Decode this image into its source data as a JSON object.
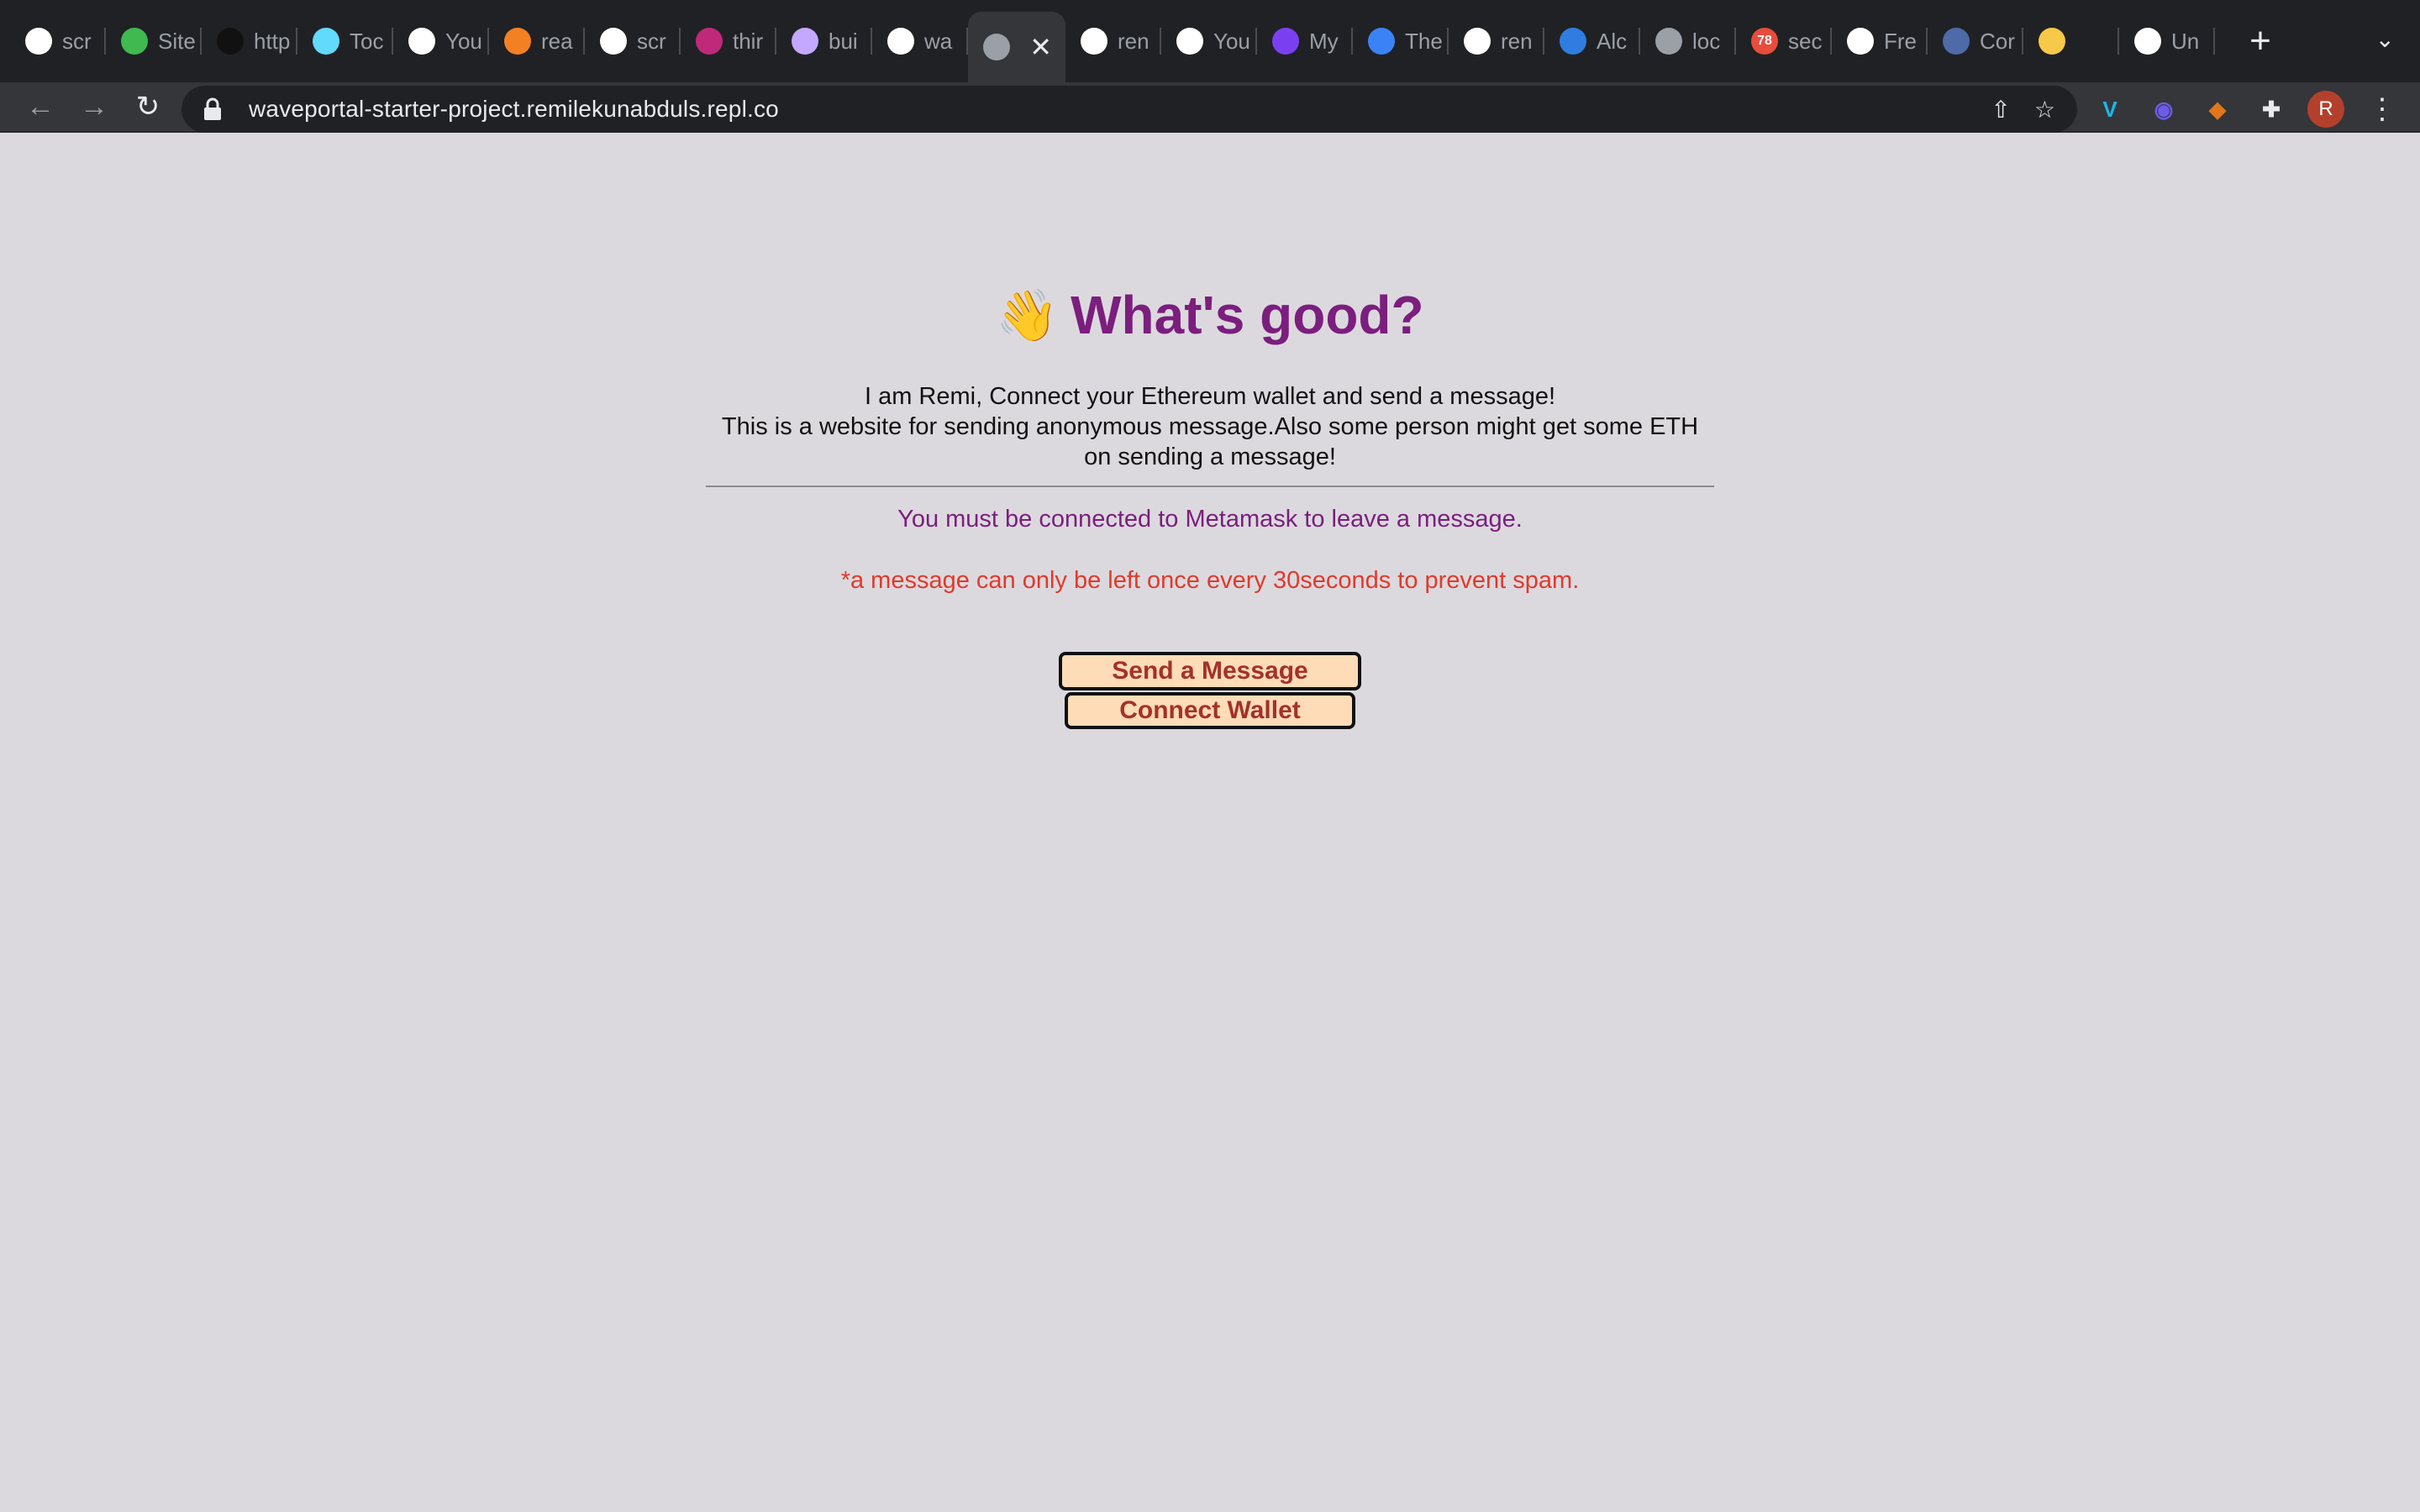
{
  "browser": {
    "tabs": [
      {
        "title": "scr",
        "icon": "google-icon",
        "color": "#ffffff"
      },
      {
        "title": "Site",
        "icon": "diamond-icon",
        "color": "#3fb950"
      },
      {
        "title": "http",
        "icon": "triangle-icon",
        "color": "#111111"
      },
      {
        "title": "Toc",
        "icon": "react-icon",
        "color": "#61dafb"
      },
      {
        "title": "You",
        "icon": "github-icon",
        "color": "#ffffff"
      },
      {
        "title": "rea",
        "icon": "stackoverflow-icon",
        "color": "#f48024"
      },
      {
        "title": "scr",
        "icon": "google-icon",
        "color": "#ffffff"
      },
      {
        "title": "thir",
        "icon": "w-icon",
        "color": "#c0297a"
      },
      {
        "title": "bui",
        "icon": "unicorn-icon",
        "color": "#c4a7ff"
      },
      {
        "title": "wa",
        "icon": "swirl-icon",
        "color": "#ffffff"
      },
      {
        "title": "",
        "icon": "globe-icon",
        "color": "#9aa0a6",
        "active": true
      },
      {
        "title": "ren",
        "icon": "github-icon",
        "color": "#ffffff"
      },
      {
        "title": "You",
        "icon": "github-icon",
        "color": "#ffffff"
      },
      {
        "title": "My",
        "icon": "people-icon",
        "color": "#7b3ff2"
      },
      {
        "title": "The",
        "icon": "ethereum-icon",
        "color": "#3b82f6"
      },
      {
        "title": "ren",
        "icon": "github-icon",
        "color": "#ffffff"
      },
      {
        "title": "Alc",
        "icon": "alchemy-icon",
        "color": "#2f7de1"
      },
      {
        "title": "loc",
        "icon": "globe-icon",
        "color": "#9aa0a6"
      },
      {
        "title": "sec",
        "icon": "badge-icon",
        "color": "#e74c3c",
        "badge": "78"
      },
      {
        "title": "Fre",
        "icon": "freecodecamp-icon",
        "color": "#ffffff"
      },
      {
        "title": "Cor",
        "icon": "moon-icon",
        "color": "#4f6aa8"
      },
      {
        "title": "",
        "icon": "emoji-icon",
        "color": "#f7c948"
      },
      {
        "title": "Un",
        "icon": "unicorn-icon",
        "color": "#ffffff"
      }
    ],
    "close_glyph": "✕",
    "newtab_glyph": "+",
    "tab_menu_glyph": "⌄",
    "nav": {
      "back": "←",
      "forward": "→",
      "reload": "↻"
    },
    "url": "waveportal-starter-project.remilekunabduls.repl.co",
    "share_glyph": "⇧",
    "star_glyph": "☆",
    "extensions": [
      {
        "name": "vimeo-icon",
        "glyph": "V",
        "color": "#1ab7ea"
      },
      {
        "name": "ghost-icon",
        "glyph": "◉",
        "color": "#6c5ce7"
      },
      {
        "name": "metamask-icon",
        "glyph": "◆",
        "color": "#e2761b"
      },
      {
        "name": "puzzle-icon",
        "glyph": "✚",
        "color": "#e8eaed"
      }
    ],
    "avatar_letter": "R",
    "menu_glyph": "⋮"
  },
  "page": {
    "wave_emoji": "👋",
    "title": "What's good?",
    "bio_line1": "I am Remi, Connect your Ethereum wallet and send a message!",
    "bio_line2": "This is a website for sending anonymous message.Also some person might get some ETH on sending a message!",
    "metamask_note": "You must be connected to Metamask to leave a message.",
    "spam_note": "*a message can only be left once every 30seconds to prevent spam.",
    "send_button": "Send a Message",
    "connect_button": "Connect Wallet"
  },
  "colors": {
    "accent": "#7b1e7e",
    "warning": "#e03a2c",
    "button_bg": "#ffdcb8",
    "button_text": "#a4312a",
    "page_bg": "#dcd9de"
  }
}
